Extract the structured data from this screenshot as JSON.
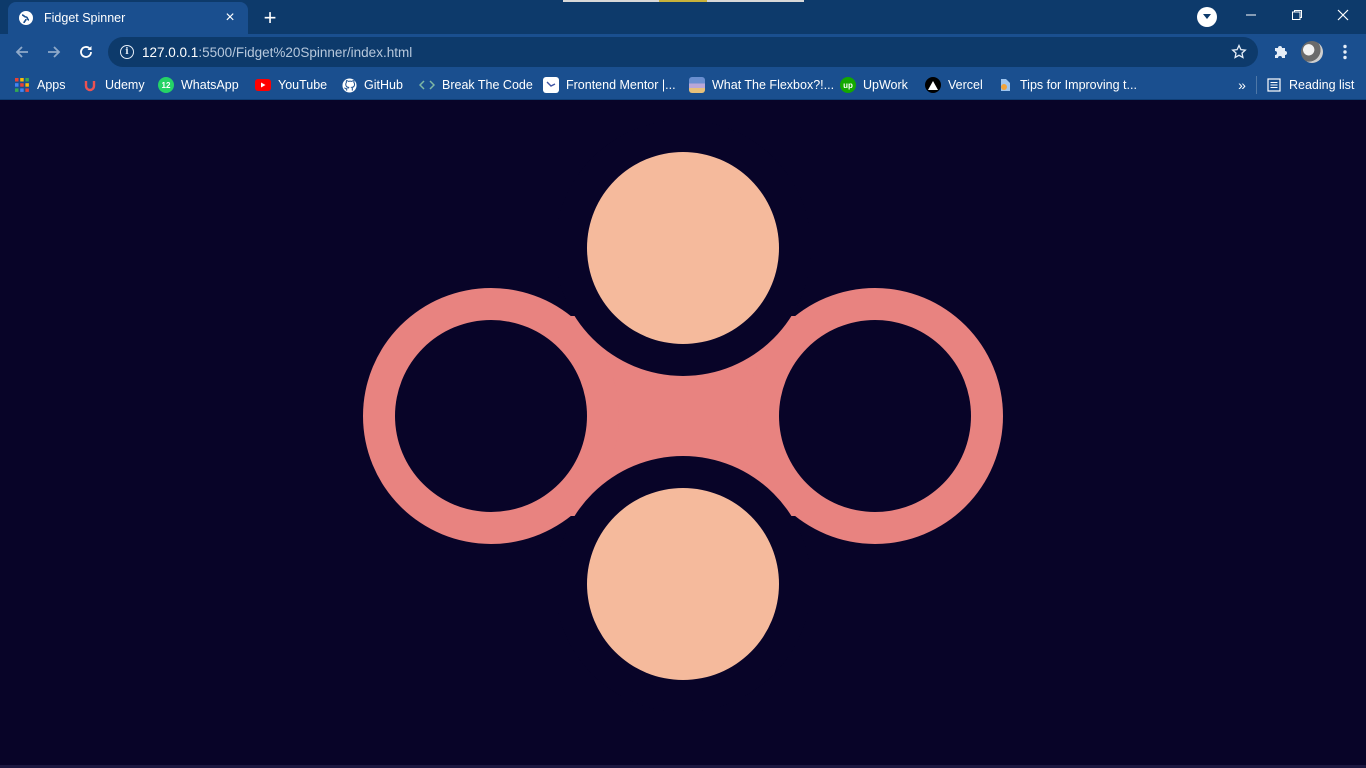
{
  "browser": {
    "tab": {
      "title": "Fidget Spinner",
      "close_glyph": "×"
    },
    "new_tab_glyph": "+",
    "window_controls": {
      "minimize": "–",
      "restore": "❐",
      "close": "✕"
    },
    "address_bar": {
      "url_host": "127.0.0.1",
      "url_path": ":5500/Fidget%20Spinner/index.html",
      "info_glyph": "i"
    },
    "bookmarks": [
      {
        "label": "Apps",
        "icon": "apps-grid-icon"
      },
      {
        "label": "Udemy",
        "icon": "udemy-icon"
      },
      {
        "label": "WhatsApp",
        "icon": "whatsapp-icon",
        "badge": "12"
      },
      {
        "label": "YouTube",
        "icon": "youtube-icon"
      },
      {
        "label": "GitHub",
        "icon": "github-icon"
      },
      {
        "label": "Break The Code",
        "icon": "code-icon"
      },
      {
        "label": "Frontend Mentor |...",
        "icon": "frontend-mentor-icon"
      },
      {
        "label": "What The Flexbox?!...",
        "icon": "flexbox-icon"
      },
      {
        "label": "UpWork",
        "icon": "upwork-icon"
      },
      {
        "label": "Vercel",
        "icon": "vercel-icon"
      },
      {
        "label": "Tips for Improving t...",
        "icon": "tips-icon"
      }
    ],
    "more_bookmarks_glyph": "»",
    "reading_list": "Reading list"
  },
  "colors": {
    "page_background": "#080428",
    "spinner_body": "#e88380",
    "spinner_weights": "#f5ba9c",
    "chrome_frame": "#0d3a6b",
    "chrome_toolbar": "#1a4f8f"
  }
}
